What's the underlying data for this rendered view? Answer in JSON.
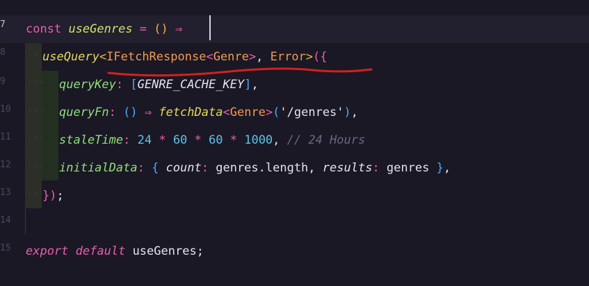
{
  "editor": {
    "line_numbers": [
      "7",
      "8",
      "9",
      "10",
      "11",
      "12",
      "13",
      "14",
      "15"
    ],
    "lines": {
      "l1": {
        "kw_const": "const",
        "name": "useGenres",
        "eq": " = ",
        "parens": "()",
        "arrow": " ⇒"
      },
      "l2": {
        "fn": "useQuery",
        "lt": "<",
        "type1": "IFetchResponse",
        "lt2": "<",
        "type2": "Genre",
        "gt2": ">",
        "comma": ", ",
        "type3": "Error",
        "gt": ">",
        "open": "({"
      },
      "l3": {
        "key": "queryKey",
        "colon": ": ",
        "open": "[",
        "value": "GENRE_CACHE_KEY",
        "close": "]",
        "comma": ","
      },
      "l4": {
        "key": "queryFn",
        "colon": ": ",
        "parens": "()",
        "arrow": " ⇒ ",
        "fn": "fetchData",
        "lt": "<",
        "type": "Genre",
        "gt": ">",
        "open": "(",
        "str": "'/genres'",
        "close": ")",
        "comma": ","
      },
      "l5": {
        "key": "staleTime",
        "colon": ": ",
        "n1": "24",
        "m1": " * ",
        "n2": "60",
        "m2": " * ",
        "n3": "60",
        "m3": " * ",
        "n4": "1000",
        "comma": ", ",
        "comment": "// 24 Hours"
      },
      "l6": {
        "key": "initialData",
        "colon": ": ",
        "open": "{ ",
        "k1": "count",
        "c1": ": ",
        "v1": "genres.length",
        "comma": ", ",
        "k2": "results",
        "c2": ": ",
        "v2": "genres",
        "close": " }",
        "comma2": ","
      },
      "l7": {
        "close": "})",
        "semi": ";"
      },
      "l9": {
        "kw_export": "export",
        "kw_default": "default",
        "name": " useGenres",
        "semi": ";"
      }
    },
    "indent_dots": {
      "outer": "··",
      "inner": "···"
    }
  },
  "colors": {
    "background": "#1a1824",
    "keyword": "#e85fb0",
    "function": "#d6e26a",
    "type": "#f29a52",
    "property": "#8fe07a",
    "number": "#5cc3e8",
    "comment": "#6b6585",
    "annotation_underline": "#d42020"
  }
}
